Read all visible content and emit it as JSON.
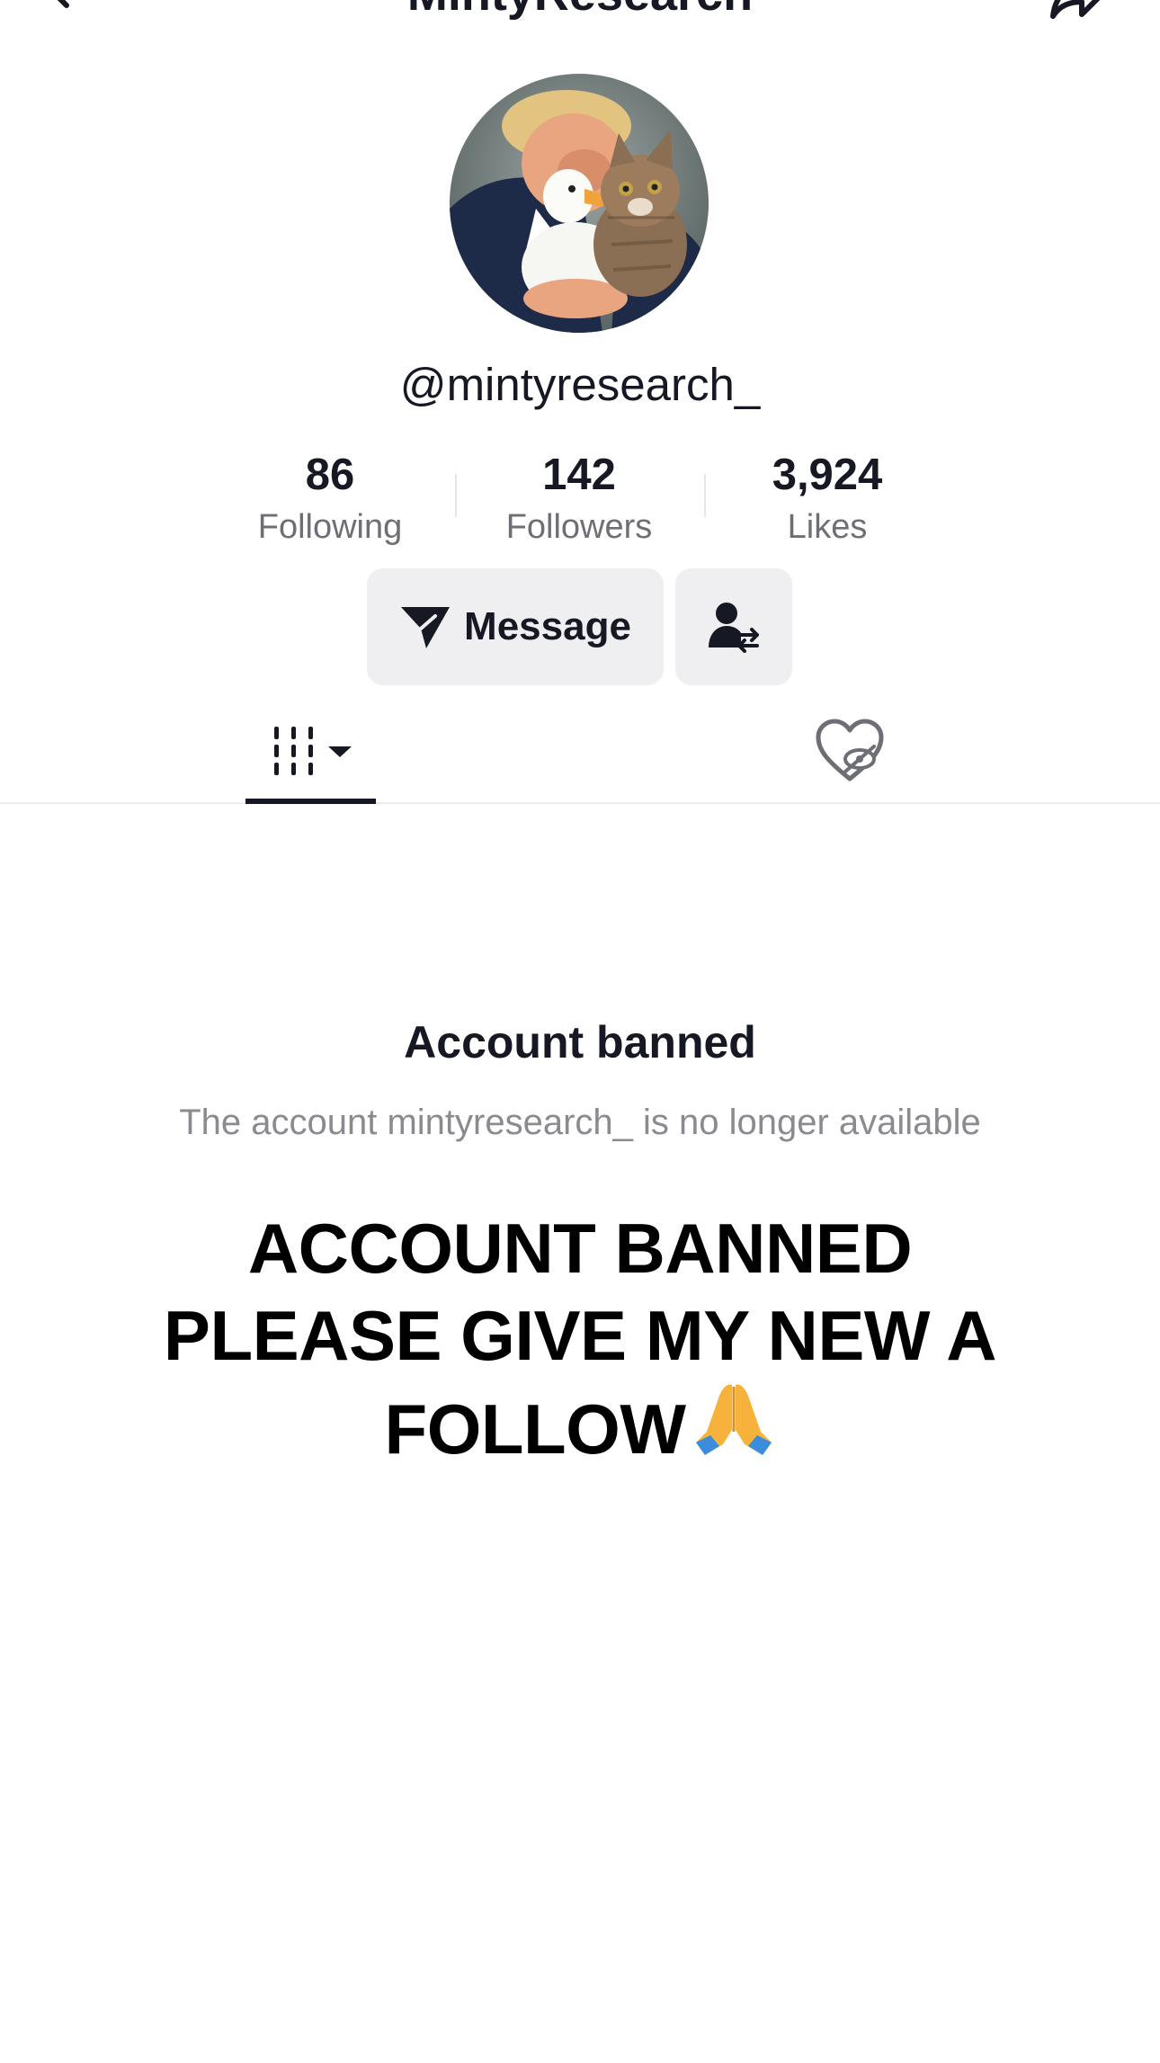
{
  "nav": {
    "title": "MintyResearch",
    "back_icon": "chevron-left-icon",
    "share_icon": "share-arrow-icon"
  },
  "profile": {
    "username": "@mintyresearch_",
    "avatar_icon": "profile-photo"
  },
  "stats": [
    {
      "value": "86",
      "label": "Following"
    },
    {
      "value": "142",
      "label": "Followers"
    },
    {
      "value": "3,924",
      "label": "Likes"
    }
  ],
  "actions": {
    "message_label": "Message",
    "message_icon": "paper-plane-icon",
    "friend_icon": "user-swap-icon"
  },
  "tabs": [
    {
      "name": "videos",
      "icon": "grid-bars-icon",
      "active": true
    },
    {
      "name": "liked",
      "icon": "heart-hidden-icon",
      "active": false
    }
  ],
  "banned": {
    "title": "Account banned",
    "description": "The account mintyresearch_ is no longer available"
  },
  "caption": {
    "line1": "ACCOUNT BANNED",
    "line2": "PLEASE GIVE MY NEW A",
    "line3": "FOLLOW",
    "emoji": "praying-hands"
  },
  "colors": {
    "text_primary": "#161823",
    "text_secondary": "#6e6f76",
    "button_bg": "#efeff1",
    "divider": "#ececee"
  }
}
